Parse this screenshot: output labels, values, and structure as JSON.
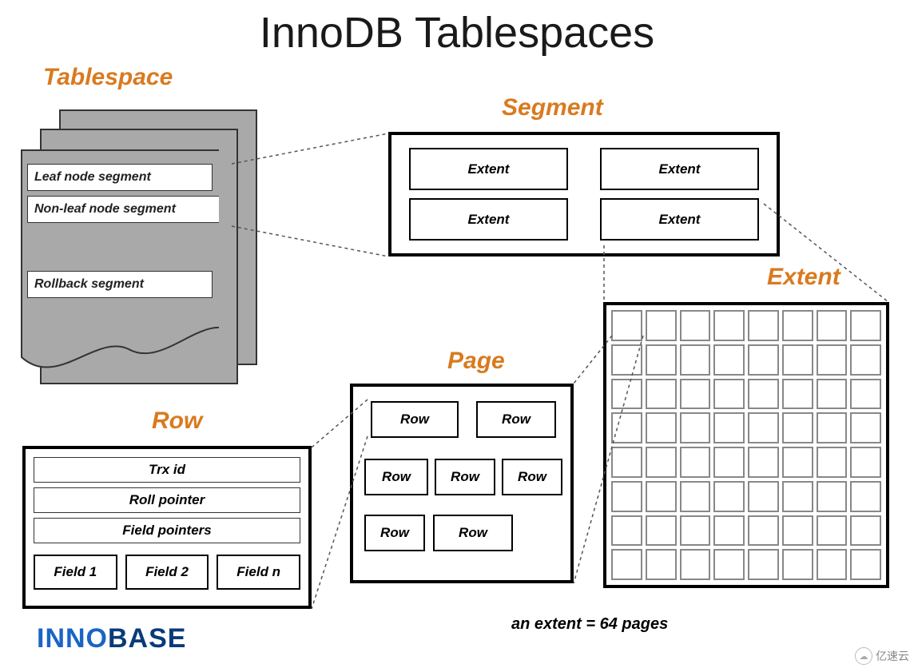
{
  "title": "InnoDB Tablespaces",
  "labels": {
    "tablespace": "Tablespace",
    "segment": "Segment",
    "row": "Row",
    "page": "Page",
    "extent": "Extent"
  },
  "tablespace_segments": {
    "leaf": "Leaf node segment",
    "nonleaf": "Non-leaf node segment",
    "rollback": "Rollback segment"
  },
  "segment": {
    "cells": [
      "Extent",
      "Extent",
      "Extent",
      "Extent"
    ]
  },
  "page": {
    "rows": [
      "Row",
      "Row",
      "Row",
      "Row",
      "Row",
      "Row",
      "Row"
    ]
  },
  "row": {
    "trx": "Trx id",
    "roll": "Roll pointer",
    "fields_ptr": "Field pointers",
    "fields": [
      "Field 1",
      "Field 2",
      "Field n"
    ]
  },
  "extent_grid": {
    "rows": 8,
    "cols": 8
  },
  "footnote": "an extent = 64 pages",
  "brand": {
    "part1": "INNO",
    "part2": "BASE"
  },
  "watermark": "亿速云"
}
